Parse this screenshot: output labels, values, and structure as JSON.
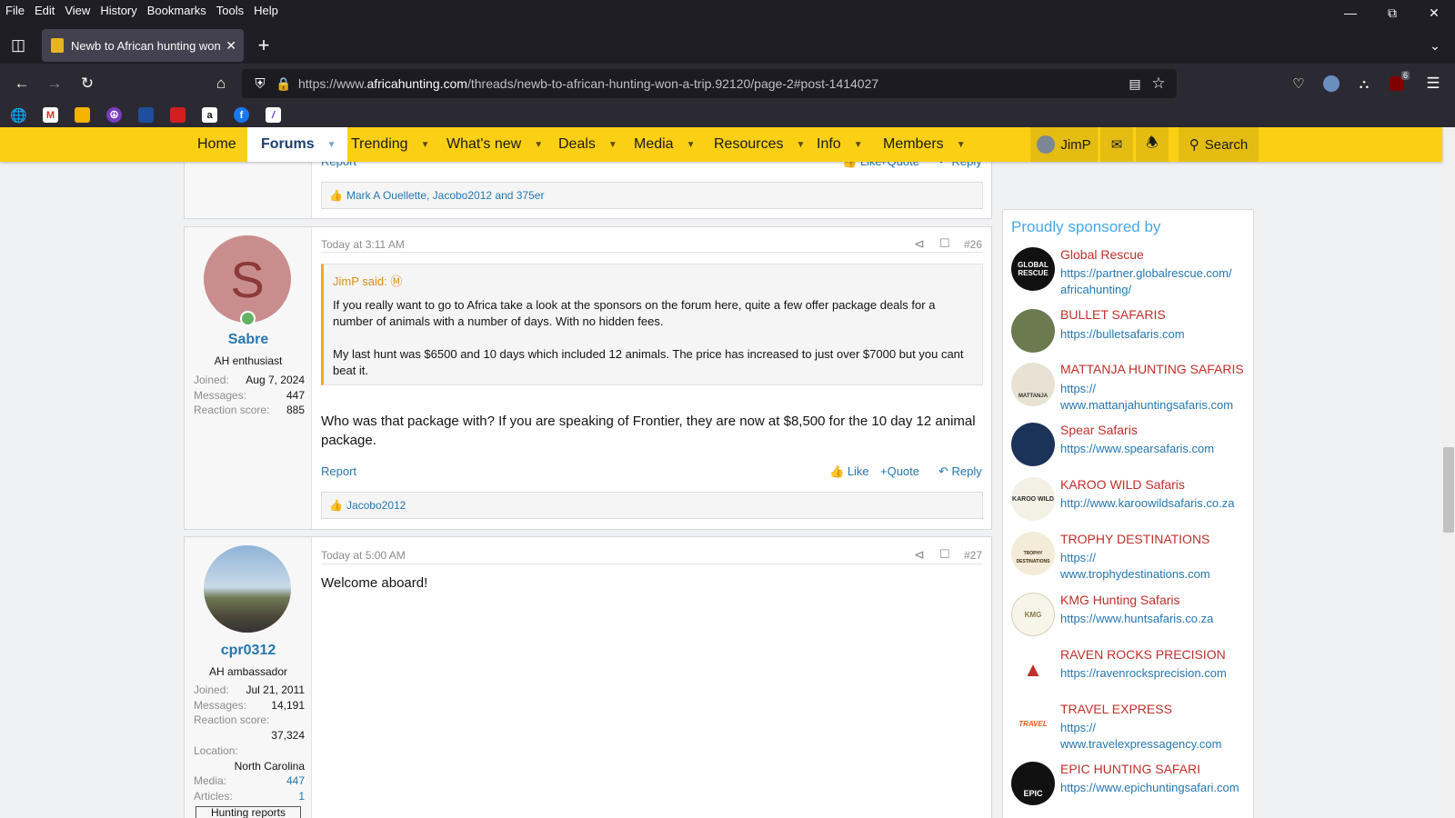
{
  "browser": {
    "menu": [
      "File",
      "Edit",
      "View",
      "History",
      "Bookmarks",
      "Tools",
      "Help"
    ],
    "tab_title": "Newb to African hunting won a",
    "url_prefix": "https://www.",
    "url_domain": "africahunting.com",
    "url_path": "/threads/newb-to-african-hunting-won-a-trip.92120/page-2#post-1414027",
    "extension_badge": "6"
  },
  "site_nav": {
    "items": [
      "Home",
      "Forums",
      "Trending",
      "What's new",
      "Deals",
      "Media",
      "Resources",
      "Info",
      "Members"
    ],
    "user": "JimP",
    "search_label": "Search"
  },
  "prev_post": {
    "actions": {
      "report": "Report",
      "like": "Like",
      "quote": "Quote",
      "reply": "Reply"
    },
    "reactions": "Mark A Ouellette, Jacobo2012 and 375er"
  },
  "post26": {
    "avatar_letter": "S",
    "username": "Sabre",
    "user_title": "AH enthusiast",
    "stats": [
      {
        "label": "Joined:",
        "value": "Aug 7, 2024"
      },
      {
        "label": "Messages:",
        "value": "447"
      },
      {
        "label": "Reaction score:",
        "value": "885"
      }
    ],
    "time": "Today at 3:11 AM",
    "number": "#26",
    "quote_author": "JimP said:",
    "quote_p1": "If you really want to go to Africa take a look at the sponsors on the forum here, quite a few offer package deals for a number of animals with a number of days. With no hidden fees.",
    "quote_p2": "My last hunt was $6500 and 10 days which included 12 animals. The price has increased to just over $7000 but you cant beat it.",
    "body": "Who was that package with? If you are speaking of Frontier, they are now at $8,500 for the 10 day 12 animal package.",
    "actions": {
      "report": "Report",
      "like": "Like",
      "quote": "Quote",
      "reply": "Reply"
    },
    "reactions": "Jacobo2012"
  },
  "post27": {
    "username": "cpr0312",
    "user_title": "AH ambassador",
    "stats": {
      "joined_label": "Joined:",
      "joined": "Jul 21, 2011",
      "messages_label": "Messages:",
      "messages": "14,191",
      "reaction_label": "Reaction score:",
      "reaction": "37,324",
      "location_label": "Location:",
      "location": "North Carolina",
      "media_label": "Media:",
      "media": "447",
      "articles_label": "Articles:",
      "articles": "1"
    },
    "hunting_reports": "Hunting reports",
    "time": "Today at 5:00 AM",
    "number": "#27",
    "body": "Welcome aboard!"
  },
  "sponsors": {
    "title": "Proudly sponsored by",
    "items": [
      {
        "name": "Global Rescue",
        "url_lines": [
          "https://partner.globalrescue.com/",
          "africahunting/"
        ],
        "logo": "GLOBAL RESCUE"
      },
      {
        "name": "BULLET SAFARIS",
        "url_lines": [
          "https://bulletsafaris.com"
        ],
        "logo": ""
      },
      {
        "name": "MATTANJA HUNTING SAFARIS",
        "url_lines": [
          "https://",
          "www.mattanjahuntingsafaris.com"
        ],
        "logo": "MATTANJA"
      },
      {
        "name": "Spear Safaris",
        "url_lines": [
          "https://www.spearsafaris.com"
        ],
        "logo": ""
      },
      {
        "name": "KAROO WILD Safaris",
        "url_lines": [
          "http://www.karoowildsafaris.co.za"
        ],
        "logo": "KAROO WILD"
      },
      {
        "name": "TROPHY DESTINATIONS",
        "url_lines": [
          "https://",
          "www.trophydestinations.com"
        ],
        "logo": "TROPHY DESTINATIONS"
      },
      {
        "name": "KMG Hunting Safaris",
        "url_lines": [
          "https://www.huntsafaris.co.za"
        ],
        "logo": "KMG"
      },
      {
        "name": "RAVEN ROCKS PRECISION",
        "url_lines": [
          "https://ravenrocksprecision.com"
        ],
        "logo": ""
      },
      {
        "name": "TRAVEL EXPRESS",
        "url_lines": [
          "https://",
          "www.travelexpressagency.com"
        ],
        "logo": "TRAVEL"
      },
      {
        "name": "EPIC HUNTING SAFARI",
        "url_lines": [
          "https://www.epichuntingsafari.com"
        ],
        "logo": "EPIC"
      }
    ]
  }
}
